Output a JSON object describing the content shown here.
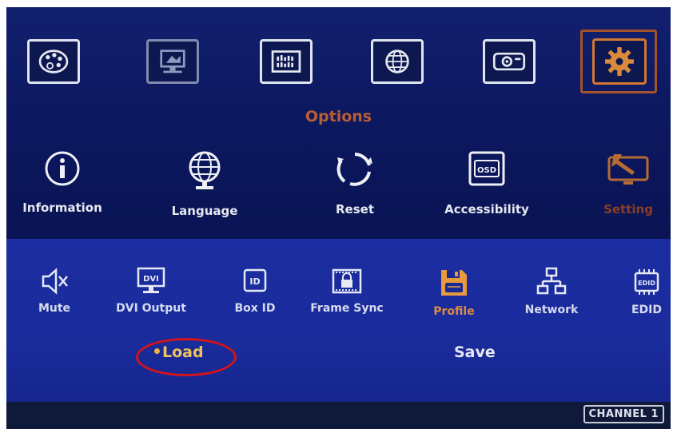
{
  "top_menu": {
    "items": [
      {
        "icon": "palette-icon"
      },
      {
        "icon": "monitor-icon"
      },
      {
        "icon": "video-wall-icon"
      },
      {
        "icon": "globe-icon"
      },
      {
        "icon": "projector-icon"
      },
      {
        "icon": "gear-icon"
      }
    ],
    "active_index": 5
  },
  "section": {
    "title": "Options"
  },
  "sub_menu": {
    "items": [
      {
        "label": "Information",
        "icon": "info-icon"
      },
      {
        "label": "Language",
        "icon": "language-globe-icon"
      },
      {
        "label": "Reset",
        "icon": "reset-icon"
      },
      {
        "label": "Accessibility",
        "icon": "osd-icon"
      },
      {
        "label": "Setting",
        "icon": "setting-tools-icon"
      }
    ],
    "active_index": 4
  },
  "tools": {
    "items": [
      {
        "label": "Mute",
        "icon": "mute-icon"
      },
      {
        "label": "DVI Output",
        "icon": "dvi-output-icon"
      },
      {
        "label": "Box ID",
        "icon": "box-id-icon"
      },
      {
        "label": "Frame Sync",
        "icon": "frame-sync-icon"
      },
      {
        "label": "Profile",
        "icon": "profile-icon"
      },
      {
        "label": "Network",
        "icon": "network-icon"
      },
      {
        "label": "EDID",
        "icon": "edid-icon"
      }
    ],
    "active_index": 4
  },
  "profile_options": {
    "load": "Load",
    "save": "Save",
    "selected": "Load"
  },
  "status": {
    "channel": "CHANNEL 1"
  },
  "colors": {
    "background": "#0b1557",
    "lower_panel": "#1b2da0",
    "active_accent": "#d2772f",
    "highlight_ring": "#d4141a"
  }
}
